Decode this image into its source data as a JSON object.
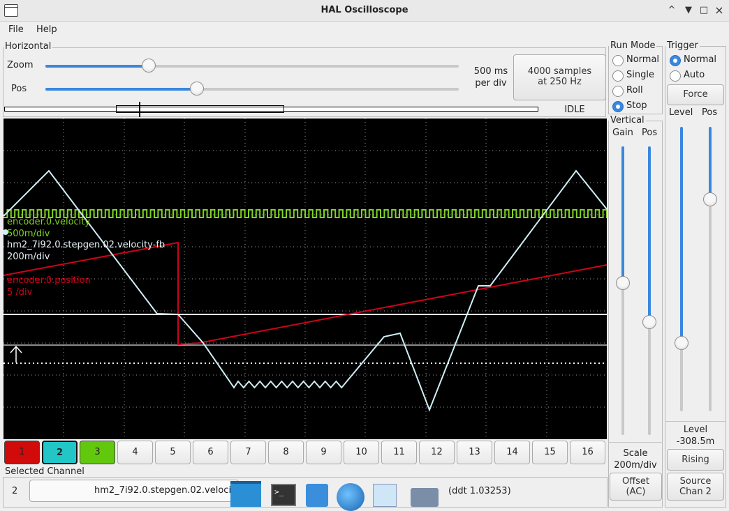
{
  "window": {
    "title": "HAL Oscilloscope",
    "controls": [
      "^",
      "×"
    ]
  },
  "menu": [
    "File",
    "Help"
  ],
  "horizontal": {
    "label": "Horizontal",
    "zoom_label": "Zoom",
    "pos_label": "Pos",
    "zoom_value": 0.28,
    "pos_value": 0.37,
    "rate_line1": "500 ms",
    "rate_line2": "per div",
    "samples_line1": "4000 samples",
    "samples_line2": "at 250 Hz",
    "status": "IDLE"
  },
  "run_mode": {
    "label": "Run Mode",
    "options": [
      "Normal",
      "Single",
      "Roll",
      "Stop"
    ],
    "selected": "Stop"
  },
  "trigger": {
    "label": "Trigger",
    "options": [
      "Normal",
      "Auto"
    ],
    "selected": "Normal",
    "force_label": "Force",
    "level_label": "Level",
    "pos_label": "Pos",
    "level_caption": "Level",
    "level_value": "-308.5m",
    "edge_label": "Rising",
    "source_line1": "Source",
    "source_line2": "Chan  2"
  },
  "vertical": {
    "label": "Vertical",
    "gain_label": "Gain",
    "pos_label": "Pos",
    "scale_caption": "Scale",
    "scale_value": "200m/div",
    "offset_line1": "Offset",
    "offset_line2": "(AC)"
  },
  "traces": [
    {
      "name": "encoder.0.velocity",
      "scale": "500m/div",
      "color": "#7ed321"
    },
    {
      "name": "hm2_7i92.0.stepgen.02.velocity-fb",
      "scale": "200m/div",
      "color": "#e8f4f8"
    },
    {
      "name": "encoder.0.position",
      "scale": "5 /div",
      "color": "#d0021b"
    }
  ],
  "channels": [
    {
      "label": "1",
      "color": "#d10a0a"
    },
    {
      "label": "2",
      "color": "#22c6c6"
    },
    {
      "label": "3",
      "color": "#62c80e"
    },
    {
      "label": "4"
    },
    {
      "label": "5"
    },
    {
      "label": "6"
    },
    {
      "label": "7"
    },
    {
      "label": "8"
    },
    {
      "label": "9"
    },
    {
      "label": "10"
    },
    {
      "label": "11"
    },
    {
      "label": "12"
    },
    {
      "label": "13"
    },
    {
      "label": "14"
    },
    {
      "label": "15"
    },
    {
      "label": "16"
    }
  ],
  "selected_channel": {
    "label": "Selected Channel",
    "number": "2",
    "name": "hm2_7i92.0.stepgen.02.veloci",
    "extra": "(ddt  1.03253)"
  },
  "colors": {
    "accent": "#3a87e0"
  }
}
